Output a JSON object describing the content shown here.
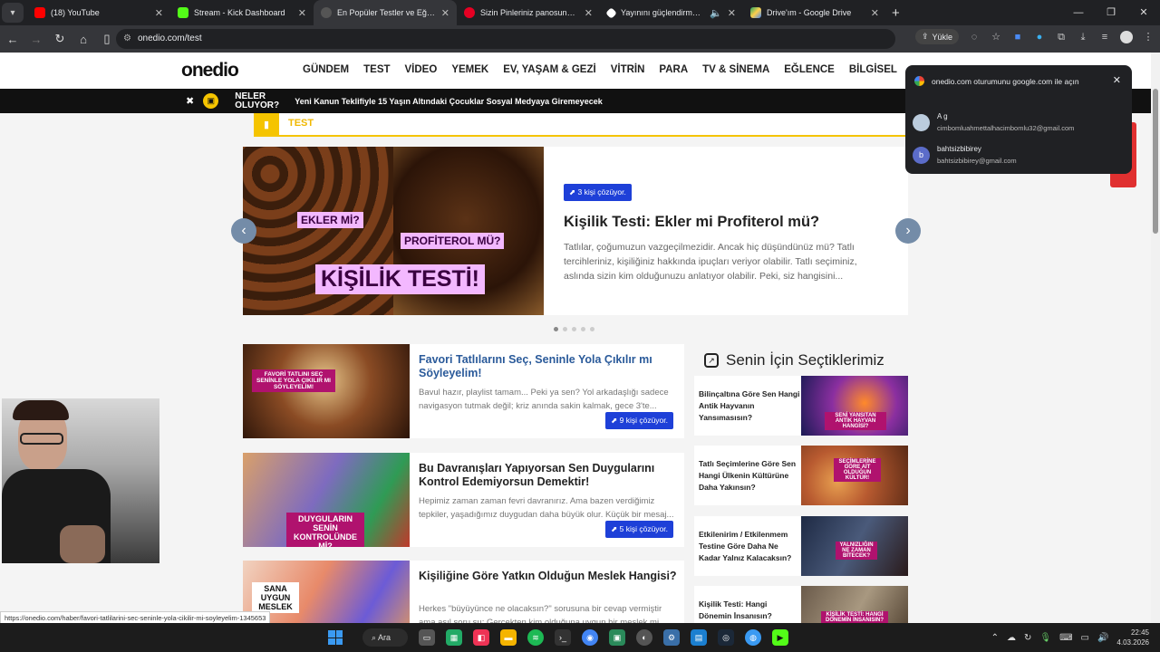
{
  "browser": {
    "tabs": [
      {
        "title": "(18) YouTube",
        "color": "#ff0000",
        "active": false
      },
      {
        "title": "Stream - Kick Dashboard",
        "color": "#53fc18",
        "active": false
      },
      {
        "title": "En Popüler Testler ve Eğlenceli",
        "color": "#222222",
        "active": true
      },
      {
        "title": "Sizin Pinleriniz panosundaki Pin",
        "color": "#e60023",
        "active": false
      },
      {
        "title": "Yayınını güçlendirmek için",
        "color": "#ffffff",
        "active": false
      },
      {
        "title": "Drive'ım - Google Drive",
        "color": "#1fa463",
        "active": false
      }
    ],
    "url": "onedio.com/test",
    "upload_label": "Yükle"
  },
  "site": {
    "logo": "onedio",
    "menu": [
      "GÜNDEM",
      "TEST",
      "VİDEO",
      "YEMEK",
      "EV, YAŞAM & GEZİ",
      "VİTRİN",
      "PARA",
      "TV & SİNEMA",
      "EĞLENCE",
      "BİLGİSEL"
    ],
    "newsbar": {
      "title": "NELER OLUYOR?",
      "headline": "Yeni Kanun Teklifiyle 15 Yaşın Altındaki Çocuklar Sosyal Medyaya Giremeyecek"
    },
    "section_label": "TEST"
  },
  "slider": {
    "img_labels": {
      "left": "EKLER Mİ?",
      "right": "PROFİTEROL MÜ?",
      "main": "KİŞİLİK TESTİ!"
    },
    "solved": "3 kişi çözüyor.",
    "title": "Kişilik Testi: Ekler mi Profiterol mü?",
    "desc": "Tatlılar, çoğumuzun vazgeçilmezidir. Ancak hiç düşündünüz mü? Tatlı tercihleriniz, kişiliğiniz hakkında ipuçları veriyor olabilir. Tatlı seçiminiz, aslında sizin kim olduğunuzu anlatıyor olabilir. Peki, siz hangisini..."
  },
  "cards": [
    {
      "title": "Favori Tatlılarını Seç, Seninle Yola Çıkılır mı Söyleyelim!",
      "desc": "Bavul hazır, playlist tamam... Peki ya sen? Yol arkadaşlığı sadece navigasyon tutmak değil; kriz anında sakin kalmak, gece 3'te...",
      "solved": "9 kişi çözüyor.",
      "img_label": "FAVORİ TATLINI SEÇ SENİNLE YOLA ÇIKILIR MI SÖYLEYELİM!"
    },
    {
      "title": "Bu Davranışları Yapıyorsan Sen Duygularını Kontrol Edemiyorsun Demektir!",
      "desc": "Hepimiz zaman zaman fevri davranırız. Ama bazen verdiğimiz tepkiler, yaşadığımız duygudan daha büyük olur. Küçük bir mesaj...",
      "solved": "5 kişi çözüyor.",
      "img_label": "DUYGULARIN SENİN KONTROLÜNDE Mİ?"
    },
    {
      "title": "Kişiliğine Göre Yatkın Olduğun Meslek Hangisi?",
      "desc": "Herkes \"büyüyünce ne olacaksın?\" sorusuna bir cevap vermiştir ama asıl soru şu: Gerçekten kim olduğuna uygun bir meslek mi...",
      "solved": "",
      "img_label": "SANA UYGUN MESLEK"
    }
  ],
  "sidebar": {
    "heading": "Senin İçin Seçtiklerimiz",
    "items": [
      {
        "title": "Bilinçaltına Göre Sen Hangi Antik Hayvanın Yansımasısın?",
        "img_label": "SENİ YANSITAN ANTİK HAYVAN HANGİSİ?"
      },
      {
        "title": "Tatlı Seçimlerine Göre Sen Hangi Ülkenin Kültürüne Daha Yakınsın?",
        "img_label": "SEÇİMLERİNE GÖRE AİT OLDUĞUN KÜLTÜR!"
      },
      {
        "title": "Etkilenirim / Etkilenmem Testine Göre Daha Ne Kadar Yalnız Kalacaksın?",
        "img_label": "YALNIZLIĞIN NE ZAMAN BİTECEK?"
      },
      {
        "title": "Kişilik Testi: Hangi Dönemin İnsanısın?",
        "img_label": "KİŞİLİK TESTİ: HANGİ DÖNEMİN İNSANISIN?"
      }
    ]
  },
  "popup": {
    "header": "onedio.com oturumunu google.com ile açın",
    "accounts": [
      {
        "name": "A g",
        "email": "cimbomluahmettalhacimbomlu32@gmail.com",
        "initial": ""
      },
      {
        "name": "bahtsizbibirey",
        "email": "bahtsizbibirey@gmail.com",
        "initial": "b"
      }
    ]
  },
  "status_url": "https://onedio.com/haber/favori-tatlilarini-sec-seninle-yola-cikilir-mi-soyleyelim-1345653",
  "taskbar": {
    "search_label": "Ara",
    "time": "22:45",
    "date": "4.03.2026"
  }
}
